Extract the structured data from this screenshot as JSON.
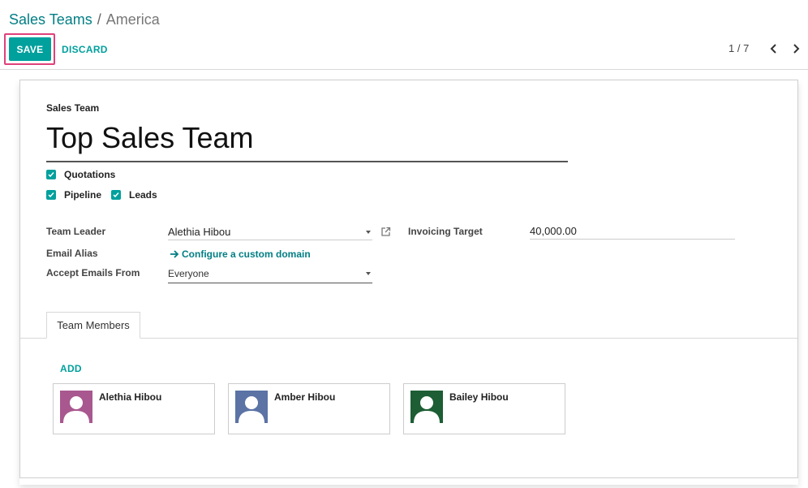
{
  "breadcrumb": {
    "parent": "Sales Teams",
    "separator": "/",
    "current": "America"
  },
  "toolbar": {
    "save_label": "SAVE",
    "discard_label": "DISCARD"
  },
  "pager": {
    "value": "1 / 7"
  },
  "form": {
    "team_label": "Sales Team",
    "team_name": "Top Sales Team",
    "checkboxes": {
      "quotations": {
        "label": "Quotations",
        "checked": true
      },
      "pipeline": {
        "label": "Pipeline",
        "checked": true
      },
      "leads": {
        "label": "Leads",
        "checked": true
      }
    },
    "team_leader": {
      "label": "Team Leader",
      "value": "Alethia Hibou"
    },
    "email_alias": {
      "label": "Email Alias",
      "link": "Configure a custom domain"
    },
    "accept_emails": {
      "label": "Accept Emails From",
      "value": "Everyone"
    },
    "invoicing_target": {
      "label": "Invoicing Target",
      "value": "40,000.00"
    }
  },
  "tabs": {
    "team_members": "Team Members"
  },
  "members": {
    "add_label": "ADD",
    "items": [
      {
        "name": "Alethia Hibou",
        "avatar_color": "#a8588f"
      },
      {
        "name": "Amber Hibou",
        "avatar_color": "#5b73a5"
      },
      {
        "name": "Bailey Hibou",
        "avatar_color": "#1d5e34"
      }
    ]
  },
  "colors": {
    "primary": "#00a09d",
    "link": "#017e84",
    "highlight": "#e0407b"
  }
}
